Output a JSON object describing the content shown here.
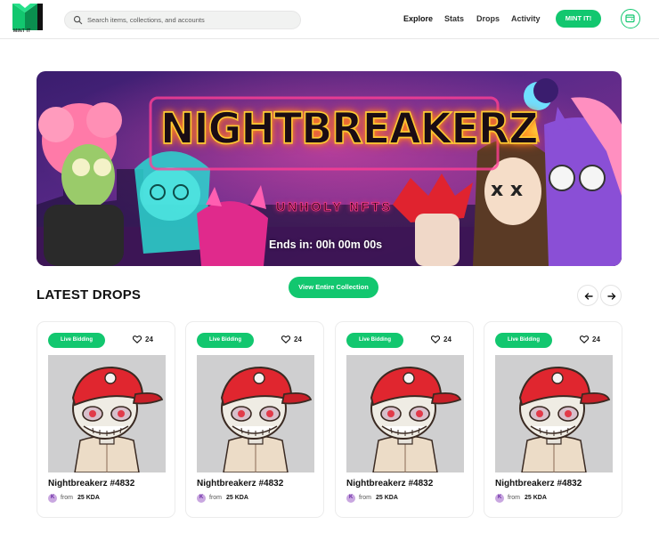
{
  "brand": {
    "logo_text": "MINT IT",
    "accent": "#12c76f"
  },
  "search": {
    "placeholder": "Search items, collections, and accounts"
  },
  "nav": {
    "items": [
      "Explore",
      "Stats",
      "Drops",
      "Activity"
    ],
    "active": "Explore"
  },
  "header": {
    "mint_label": "MINT IT!"
  },
  "banner": {
    "title": "NIGHTBREAKERZ",
    "subtitle": "UNHOLY NFTS",
    "timer": "Ends in: 00h 00m 00s"
  },
  "section": {
    "title": "LATEST DROPS",
    "view_all_label": "View Entire Collection"
  },
  "cards": [
    {
      "badge": "Live Bidding",
      "likes": "24",
      "title": "Nightbreakerz #4832",
      "from": "from",
      "price": "25 KDA",
      "coin": "K"
    },
    {
      "badge": "Live Bidding",
      "likes": "24",
      "title": "Nightbreakerz #4832",
      "from": "from",
      "price": "25 KDA",
      "coin": "K"
    },
    {
      "badge": "Live Bidding",
      "likes": "24",
      "title": "Nightbreakerz #4832",
      "from": "from",
      "price": "25 KDA",
      "coin": "K"
    },
    {
      "badge": "Live Bidding",
      "likes": "24",
      "title": "Nightbreakerz #4832",
      "from": "from",
      "price": "25 KDA",
      "coin": "K"
    }
  ]
}
